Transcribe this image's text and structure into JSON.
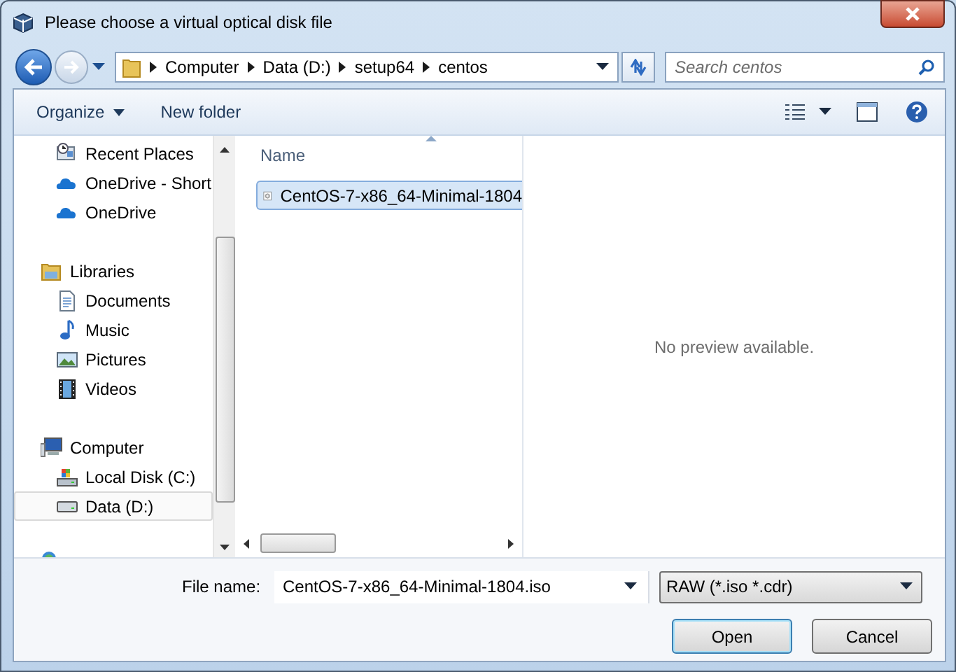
{
  "window": {
    "title": "Please choose a virtual optical disk file"
  },
  "address_bar": {
    "crumbs": [
      "Computer",
      "Data (D:)",
      "setup64",
      "centos"
    ]
  },
  "search": {
    "placeholder": "Search centos"
  },
  "toolbar": {
    "buttons": [
      {
        "label": "Organize",
        "dropdown": true
      },
      {
        "label": "New folder",
        "dropdown": false
      }
    ]
  },
  "nav_pane": {
    "sections": [
      {
        "children": [
          {
            "label": "Recent Places",
            "kind": "recent",
            "selected": false
          },
          {
            "label": "OneDrive - Short",
            "kind": "cloud",
            "selected": false
          },
          {
            "label": "OneDrive",
            "kind": "cloud",
            "selected": false
          }
        ]
      },
      {
        "label": "Libraries",
        "kind": "library",
        "children": [
          {
            "label": "Documents",
            "kind": "documents",
            "selected": false
          },
          {
            "label": "Music",
            "kind": "music",
            "selected": false
          },
          {
            "label": "Pictures",
            "kind": "pictures",
            "selected": false
          },
          {
            "label": "Videos",
            "kind": "videos",
            "selected": false
          }
        ]
      },
      {
        "label": "Computer",
        "kind": "computer",
        "children": [
          {
            "label": "Local Disk (C:)",
            "kind": "system-disk",
            "selected": false
          },
          {
            "label": "Data (D:)",
            "kind": "drive",
            "selected": true
          }
        ]
      }
    ]
  },
  "file_list": {
    "columns": [
      "Name"
    ],
    "rows": [
      {
        "name": "CentOS-7-x86_64-Minimal-1804",
        "selected": true
      }
    ]
  },
  "preview": {
    "text": "No preview available."
  },
  "file_name": {
    "label": "File name:",
    "value": "CentOS-7-x86_64-Minimal-1804.iso"
  },
  "file_type": {
    "value": "RAW (*.iso *.cdr)"
  },
  "buttons": [
    {
      "label": "Open",
      "default": true
    },
    {
      "label": "Cancel",
      "default": false
    }
  ]
}
